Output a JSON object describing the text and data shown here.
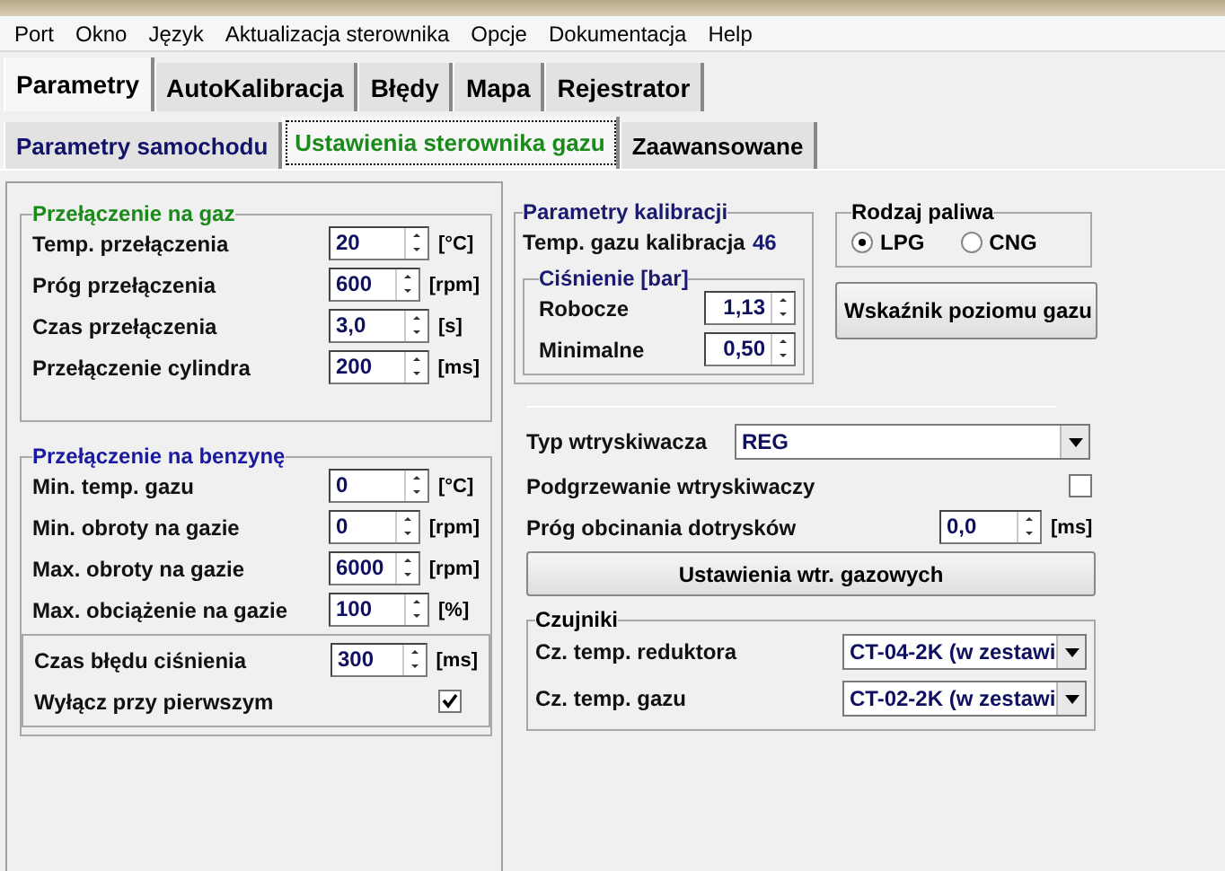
{
  "menu": [
    "Port",
    "Okno",
    "Język",
    "Aktualizacja sterownika",
    "Opcje",
    "Dokumentacja",
    "Help"
  ],
  "tabs": [
    {
      "label": "Parametry",
      "selected": true
    },
    {
      "label": "AutoKalibracja",
      "selected": false
    },
    {
      "label": "Błędy",
      "selected": false
    },
    {
      "label": "Mapa",
      "selected": false
    },
    {
      "label": "Rejestrator",
      "selected": false
    }
  ],
  "subtabs": [
    {
      "label": "Parametry samochodu",
      "selected": false
    },
    {
      "label": "Ustawienia sterownika gazu",
      "selected": true
    },
    {
      "label": "Zaawansowane",
      "selected": false
    }
  ],
  "gas_switch": {
    "title": "Przełączenie na gaz",
    "rows": [
      {
        "label": "Temp. przełączenia",
        "value": "20",
        "unit": "[°C]"
      },
      {
        "label": "Próg przełączenia",
        "value": "600",
        "unit": "[rpm]"
      },
      {
        "label": "Czas przełączenia",
        "value": "3,0",
        "unit": "[s]"
      },
      {
        "label": "Przełączenie cylindra",
        "value": "200",
        "unit": "[ms]"
      }
    ]
  },
  "petrol_switch": {
    "title": "Przełączenie na benzynę",
    "rows": [
      {
        "label": "Min. temp. gazu",
        "value": "0",
        "unit": "[°C]"
      },
      {
        "label": "Min. obroty na gazie",
        "value": "0",
        "unit": "[rpm]"
      },
      {
        "label": "Max. obroty na gazie",
        "value": "6000",
        "unit": "[rpm]"
      },
      {
        "label": "Max. obciążenie na gazie",
        "value": "100",
        "unit": "[%]"
      }
    ],
    "pressure_error": {
      "label": "Czas błędu ciśnienia",
      "value": "300",
      "unit": "[ms]"
    },
    "first_off": {
      "label": "Wyłącz przy pierwszym",
      "checked": true
    }
  },
  "calibration": {
    "title": "Parametry kalibracji",
    "temp_label": "Temp. gazu kalibracja",
    "temp_value": "46",
    "pressure": {
      "title": "Ciśnienie [bar]",
      "rows": [
        {
          "label": "Robocze",
          "value": "1,13"
        },
        {
          "label": "Minimalne",
          "value": "0,50"
        }
      ]
    }
  },
  "fuel_type": {
    "title": "Rodzaj paliwa",
    "options": [
      {
        "label": "LPG",
        "selected": true
      },
      {
        "label": "CNG",
        "selected": false
      }
    ]
  },
  "gauge_button": "Wskaźnik poziomu gazu",
  "injector": {
    "type_label": "Typ wtryskiwacza",
    "type_value": "REG",
    "heating": {
      "label": "Podgrzewanie wtryskiwaczy",
      "checked": false
    },
    "cutoff": {
      "label": "Próg obcinania dotrysków",
      "value": "0,0",
      "unit": "[ms]"
    },
    "settings_button": "Ustawienia wtr. gazowych"
  },
  "sensors": {
    "title": "Czujniki",
    "rows": [
      {
        "label": "Cz. temp. reduktora",
        "value": "CT-04-2K (w zestawi"
      },
      {
        "label": "Cz. temp. gazu",
        "value": "CT-02-2K (w zestawi"
      }
    ]
  }
}
